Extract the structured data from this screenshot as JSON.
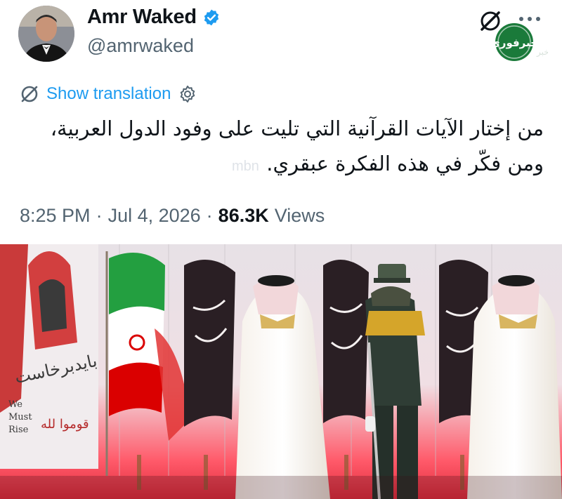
{
  "author": {
    "name": "Amr Waked",
    "handle": "@amrwaked",
    "verified": true,
    "verified_color": "#1d9bf0"
  },
  "header_icons": [
    "grok-icon",
    "more-dots-icon"
  ],
  "watermark_logo": {
    "text": "خبرفوری",
    "color": "#1a7a3a"
  },
  "translation": {
    "label": "Show translation",
    "color": "#1d9bf0"
  },
  "tweet": {
    "lines": [
      "من إختار الآيات القرآنية التي تليت على وفود الدول العربية،",
      "ومن فكّر في هذه الفكرة عبقري."
    ],
    "watermark": "mbn"
  },
  "meta": {
    "time": "8:25 PM",
    "date": "Jul 4, 2026",
    "views_count": "86.3K",
    "views_label": "Views",
    "separator": "·"
  },
  "media": {
    "banner_en": [
      "We",
      "Must",
      "Rise"
    ],
    "banner_ar": "قوموا لله"
  }
}
